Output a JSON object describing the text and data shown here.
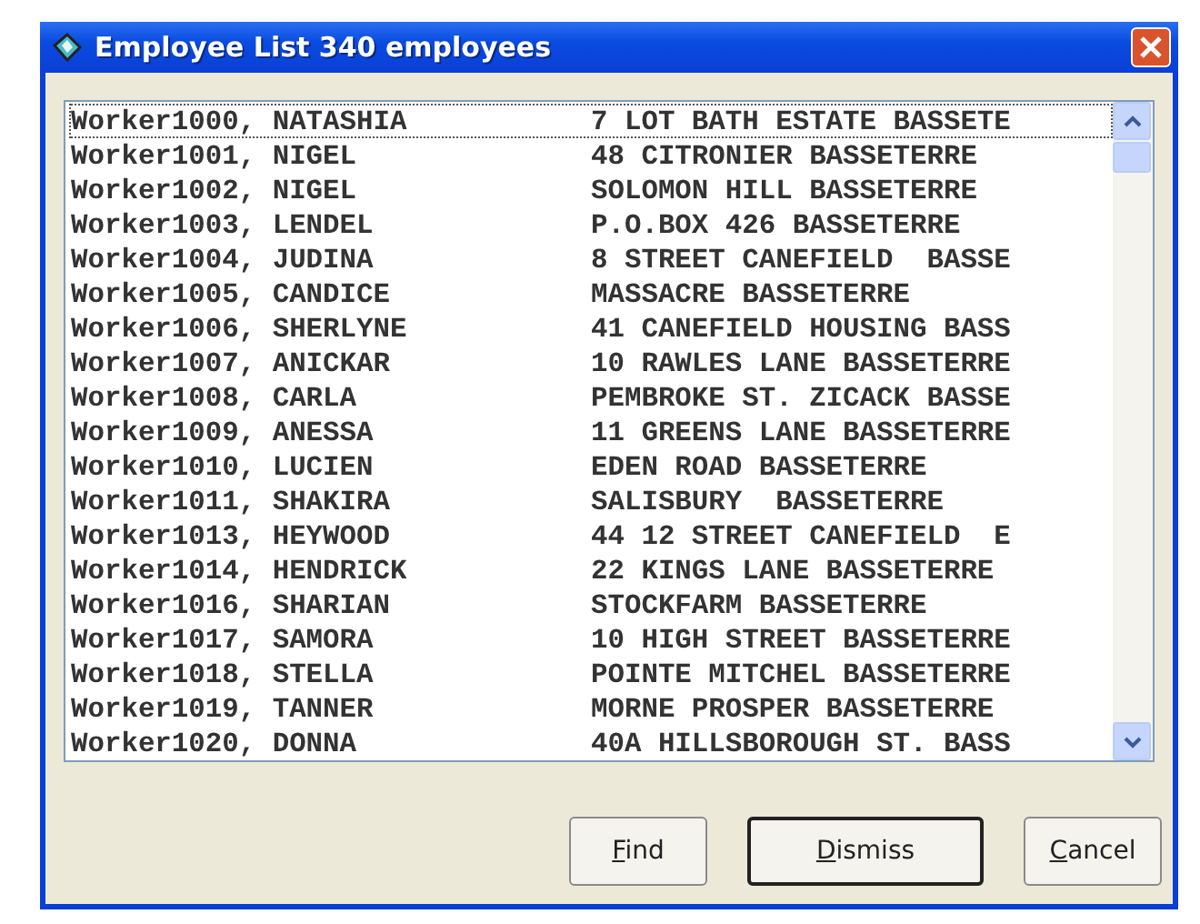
{
  "window": {
    "title": "Employee List 340 employees"
  },
  "list": {
    "rows": [
      {
        "name": "Worker1000, NATASHIA",
        "address": "7 LOT BATH ESTATE BASSETE",
        "selected": true
      },
      {
        "name": "Worker1001, NIGEL",
        "address": "48 CITRONIER BASSETERRE",
        "selected": false
      },
      {
        "name": "Worker1002, NIGEL",
        "address": "SOLOMON HILL BASSETERRE",
        "selected": false
      },
      {
        "name": "Worker1003, LENDEL",
        "address": "P.O.BOX 426 BASSETERRE",
        "selected": false
      },
      {
        "name": "Worker1004, JUDINA",
        "address": "8 STREET CANEFIELD  BASSE",
        "selected": false
      },
      {
        "name": "Worker1005, CANDICE",
        "address": "MASSACRE BASSETERRE",
        "selected": false
      },
      {
        "name": "Worker1006, SHERLYNE",
        "address": "41 CANEFIELD HOUSING BASS",
        "selected": false
      },
      {
        "name": "Worker1007, ANICKAR",
        "address": "10 RAWLES LANE BASSETERRE",
        "selected": false
      },
      {
        "name": "Worker1008, CARLA",
        "address": "PEMBROKE ST. ZICACK BASSE",
        "selected": false
      },
      {
        "name": "Worker1009, ANESSA",
        "address": "11 GREENS LANE BASSETERRE",
        "selected": false
      },
      {
        "name": "Worker1010, LUCIEN",
        "address": "EDEN ROAD BASSETERRE",
        "selected": false
      },
      {
        "name": "Worker1011, SHAKIRA",
        "address": "SALISBURY  BASSETERRE",
        "selected": false
      },
      {
        "name": "Worker1013, HEYWOOD",
        "address": "44 12 STREET CANEFIELD  E",
        "selected": false
      },
      {
        "name": "Worker1014, HENDRICK",
        "address": "22 KINGS LANE BASSETERRE",
        "selected": false
      },
      {
        "name": "Worker1016, SHARIAN",
        "address": "STOCKFARM BASSETERRE",
        "selected": false
      },
      {
        "name": "Worker1017, SAMORA",
        "address": "10 HIGH STREET BASSETERRE",
        "selected": false
      },
      {
        "name": "Worker1018, STELLA",
        "address": "POINTE MITCHEL BASSETERRE",
        "selected": false
      },
      {
        "name": "Worker1019, TANNER",
        "address": "MORNE PROSPER BASSETERRE",
        "selected": false
      },
      {
        "name": "Worker1020, DONNA",
        "address": "40A HILLSBOROUGH ST. BASS",
        "selected": false
      }
    ]
  },
  "buttons": [
    {
      "label": "Find",
      "default": false
    },
    {
      "label": "Dismiss",
      "default": true
    },
    {
      "label": "Cancel",
      "default": false
    }
  ]
}
